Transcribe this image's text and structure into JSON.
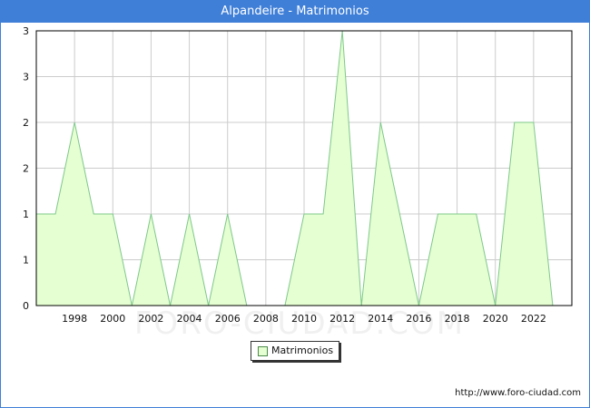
{
  "title": "Alpandeire - Matrimonios",
  "credit": "http://www.foro-ciudad.com",
  "watermark": "FORO-CIUDAD.COM",
  "colors": {
    "header": "#3f7fd8",
    "fill": "#e6ffd2",
    "line": "#7dc88a",
    "grid": "#cccccc"
  },
  "chart_data": {
    "type": "area",
    "series": [
      {
        "name": "Matrimonios",
        "x": [
          1996,
          1997,
          1998,
          1999,
          2000,
          2001,
          2002,
          2003,
          2004,
          2005,
          2006,
          2007,
          2008,
          2009,
          2010,
          2011,
          2012,
          2013,
          2014,
          2015,
          2016,
          2017,
          2018,
          2019,
          2020,
          2021,
          2022,
          2023
        ],
        "values": [
          1,
          1,
          2,
          1,
          1,
          0,
          1,
          0,
          1,
          0,
          1,
          0,
          0,
          0,
          1,
          1,
          3,
          0,
          2,
          1,
          0,
          1,
          1,
          1,
          0,
          2,
          2,
          0
        ]
      }
    ],
    "x_ticks": [
      "1998",
      "2000",
      "2002",
      "2004",
      "2006",
      "2008",
      "2010",
      "2012",
      "2014",
      "2016",
      "2018",
      "2020",
      "2022"
    ],
    "y_ticks": [
      "0",
      "1",
      "1",
      "2",
      "2",
      "3",
      "3"
    ],
    "ylim": [
      0,
      3
    ],
    "grid": true,
    "legend": "bottom-center"
  }
}
